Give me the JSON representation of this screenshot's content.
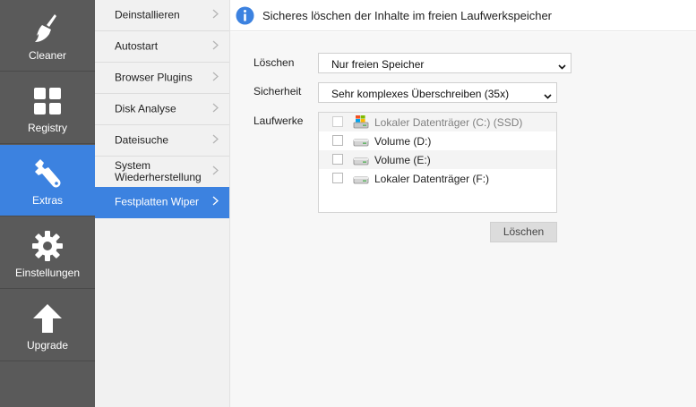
{
  "rail": {
    "items": [
      {
        "label": "Cleaner",
        "icon": "broom-icon"
      },
      {
        "label": "Registry",
        "icon": "grid-icon"
      },
      {
        "label": "Extras",
        "icon": "wrench-icon"
      },
      {
        "label": "Einstellungen",
        "icon": "gear-icon"
      },
      {
        "label": "Upgrade",
        "icon": "arrow-up-icon"
      }
    ]
  },
  "submenu": {
    "items": [
      {
        "label": "Deinstallieren"
      },
      {
        "label": "Autostart"
      },
      {
        "label": "Browser Plugins"
      },
      {
        "label": "Disk Analyse"
      },
      {
        "label": "Dateisuche"
      },
      {
        "label": "System Wiederherstellung"
      },
      {
        "label": "Festplatten Wiper"
      }
    ]
  },
  "header": {
    "title": "Sicheres löschen der Inhalte im freien Laufwerkspeicher"
  },
  "form": {
    "loeschen_label": "Löschen",
    "loeschen_value": "Nur freien Speicher",
    "sicherheit_label": "Sicherheit",
    "sicherheit_value": "Sehr komplexes Überschreiben (35x)",
    "laufwerke_label": "Laufwerke",
    "drives": [
      {
        "label": "Lokaler Datenträger (C:) (SSD)",
        "icon": "windows-drive-icon",
        "disabled": true
      },
      {
        "label": "Volume (D:)",
        "icon": "drive-icon",
        "disabled": false
      },
      {
        "label": "Volume (E:)",
        "icon": "drive-icon",
        "disabled": false
      },
      {
        "label": "Lokaler Datenträger (F:)",
        "icon": "drive-icon",
        "disabled": false
      }
    ],
    "submit_label": "Löschen"
  },
  "colors": {
    "accent": "#3c82e0",
    "rail": "#5a5a5a",
    "submenu": "#f1f1f1"
  }
}
